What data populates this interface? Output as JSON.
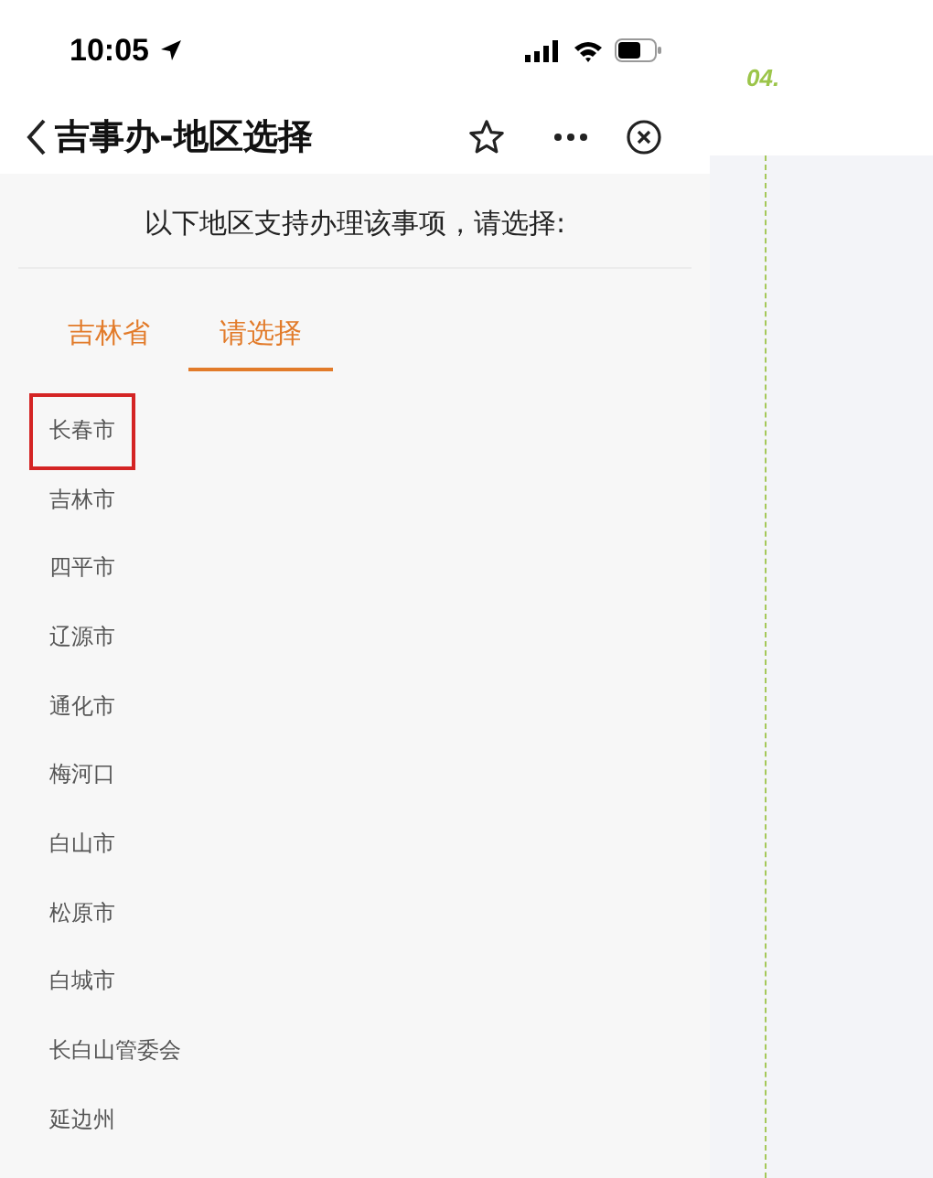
{
  "status_bar": {
    "time": "10:05"
  },
  "nav": {
    "title": "吉事办-地区选择"
  },
  "subtitle": "以下地区支持办理该事项，请选择:",
  "tabs": [
    {
      "label": "吉林省",
      "selected": false
    },
    {
      "label": "请选择",
      "selected": true
    }
  ],
  "regions": [
    {
      "name": "长春市",
      "highlighted": true
    },
    {
      "name": "吉林市",
      "highlighted": false
    },
    {
      "name": "四平市",
      "highlighted": false
    },
    {
      "name": "辽源市",
      "highlighted": false
    },
    {
      "name": "通化市",
      "highlighted": false
    },
    {
      "name": "梅河口",
      "highlighted": false
    },
    {
      "name": "白山市",
      "highlighted": false
    },
    {
      "name": "松原市",
      "highlighted": false
    },
    {
      "name": "白城市",
      "highlighted": false
    },
    {
      "name": "长白山管委会",
      "highlighted": false
    },
    {
      "name": "延边州",
      "highlighted": false
    }
  ],
  "step": {
    "number": "04."
  }
}
